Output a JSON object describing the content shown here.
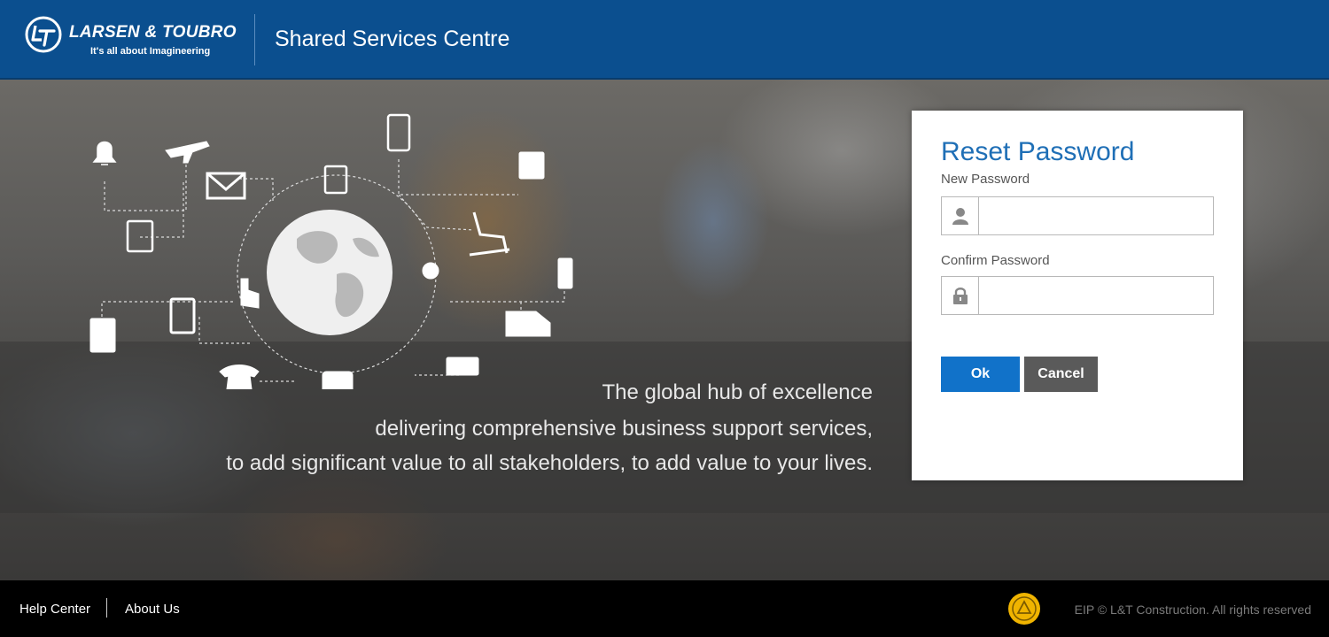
{
  "header": {
    "brand_name": "LARSEN & TOUBRO",
    "brand_tagline": "It's all about Imagineering",
    "app_title": "Shared Services Centre"
  },
  "hero": {
    "tagline_lines": [
      "The global hub of excellence",
      "delivering comprehensive business support services,",
      "to add significant value to all stakeholders, to add value to your lives."
    ],
    "icons": [
      "bell-icon",
      "airplane-icon",
      "mobile-phone-icon",
      "pdf-download-icon",
      "envelope-icon",
      "clipboard-check-icon",
      "document-edit-icon",
      "recliner-icon",
      "globe-icon",
      "touch-hand-icon",
      "user-settings-icon",
      "usb-drive-icon",
      "fuel-pump-icon",
      "ambulance-icon",
      "invoice-dollar-icon",
      "telephone-icon",
      "wallet-icon",
      "printer-icon"
    ]
  },
  "reset_form": {
    "title": "Reset Password",
    "new_password_label": "New Password",
    "new_password_value": "",
    "new_password_icon": "user-icon",
    "confirm_password_label": "Confirm Password",
    "confirm_password_value": "",
    "confirm_password_icon": "lock-icon",
    "ok_label": "Ok",
    "cancel_label": "Cancel",
    "colors": {
      "title": "#1f6fb6",
      "ok": "#1172c9",
      "cancel": "#5a5a5a"
    }
  },
  "footer": {
    "help_label": "Help Center",
    "about_label": "About Us",
    "copyright": "EIP © L&T Construction. All rights reserved"
  },
  "colors": {
    "header": "#0b4f8f",
    "footer": "#000000"
  }
}
